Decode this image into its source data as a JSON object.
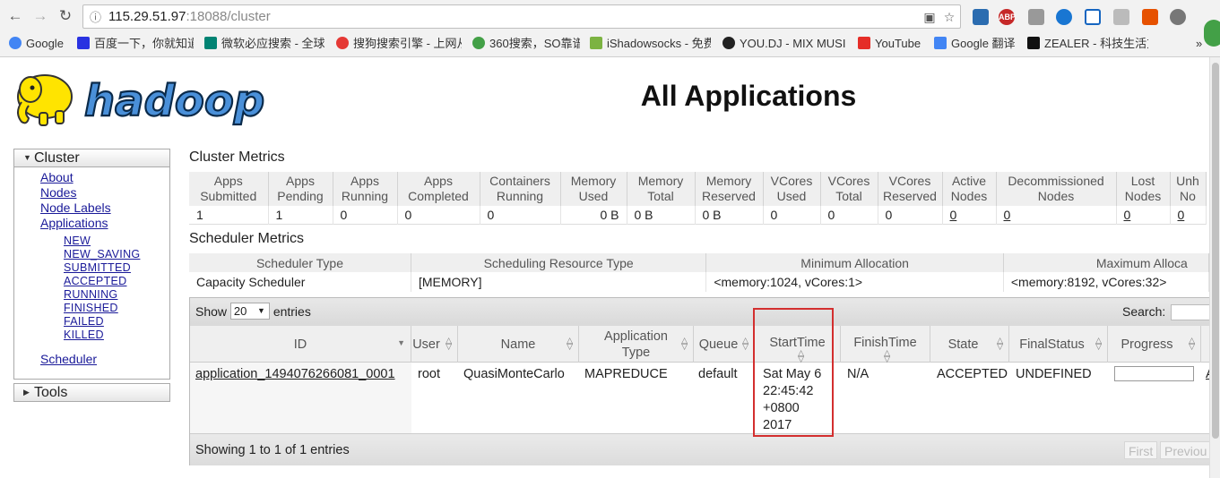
{
  "browser": {
    "url_host": "115.29.51.97",
    "url_rest": ":18088/cluster",
    "bookmarks": [
      "Google",
      "百度一下，你就知道",
      "微软必应搜索 - 全球",
      "搜狗搜索引擎 - 上网从",
      "360搜索，SO靠谱",
      "iShadowsocks - 免费",
      "YOU.DJ - MIX MUSI",
      "YouTube",
      "Google 翻译",
      "ZEALER - 科技生活方"
    ],
    "extensions": [
      "ABP"
    ]
  },
  "page": {
    "title": "All Applications",
    "logo_text": "hadoop"
  },
  "sidebar": {
    "cluster_label": "Cluster",
    "tools_label": "Tools",
    "links": [
      "About",
      "Nodes",
      "Node Labels",
      "Applications"
    ],
    "states": [
      "NEW",
      "NEW_SAVING",
      "SUBMITTED",
      "ACCEPTED",
      "RUNNING",
      "FINISHED",
      "FAILED",
      "KILLED"
    ],
    "scheduler": "Scheduler"
  },
  "cluster_metrics": {
    "title": "Cluster Metrics",
    "headers": [
      [
        "Apps",
        "Submitted"
      ],
      [
        "Apps",
        "Pending"
      ],
      [
        "Apps",
        "Running"
      ],
      [
        "Apps",
        "Completed"
      ],
      [
        "Containers",
        "Running"
      ],
      [
        "Memory",
        "Used"
      ],
      [
        "Memory",
        "Total"
      ],
      [
        "Memory",
        "Reserved"
      ],
      [
        "VCores",
        "Used"
      ],
      [
        "VCores",
        "Total"
      ],
      [
        "VCores",
        "Reserved"
      ],
      [
        "Active",
        "Nodes"
      ],
      [
        "Decommissioned",
        "Nodes"
      ],
      [
        "Lost",
        "Nodes"
      ],
      [
        "Unh",
        "No"
      ]
    ],
    "values": [
      "1",
      "1",
      "0",
      "0",
      "0",
      "0 B",
      "0 B",
      "0 B",
      "0",
      "0",
      "0",
      "0",
      "0",
      "0",
      "0"
    ]
  },
  "scheduler_metrics": {
    "title": "Scheduler Metrics",
    "headers": [
      "Scheduler Type",
      "Scheduling Resource Type",
      "Minimum Allocation",
      "Maximum Alloca"
    ],
    "values": [
      "Capacity Scheduler",
      "[MEMORY]",
      "<memory:1024, vCores:1>",
      "<memory:8192, vCores:32>"
    ]
  },
  "apps": {
    "show_label": "Show",
    "entries_count": "20",
    "entries_label": "entries",
    "search_label": "Search:",
    "headers": [
      "ID",
      "User",
      "Name",
      "Application Type",
      "Queue",
      "StartTime",
      "FinishTime",
      "State",
      "FinalStatus",
      "Progress"
    ],
    "row": {
      "id": "application_1494076266081_0001",
      "user": "root",
      "name": "QuasiMonteCarlo",
      "type": "MAPREDUCE",
      "queue": "default",
      "start": [
        "Sat May 6",
        "22:45:42",
        "+0800",
        "2017"
      ],
      "finish": "N/A",
      "state": "ACCEPTED",
      "final_status": "UNDEFINED",
      "progress_pct": 0,
      "tracking": "A"
    },
    "footer": "Showing 1 to 1 of 1 entries",
    "first_label": "First",
    "previous_label": "Previou"
  }
}
